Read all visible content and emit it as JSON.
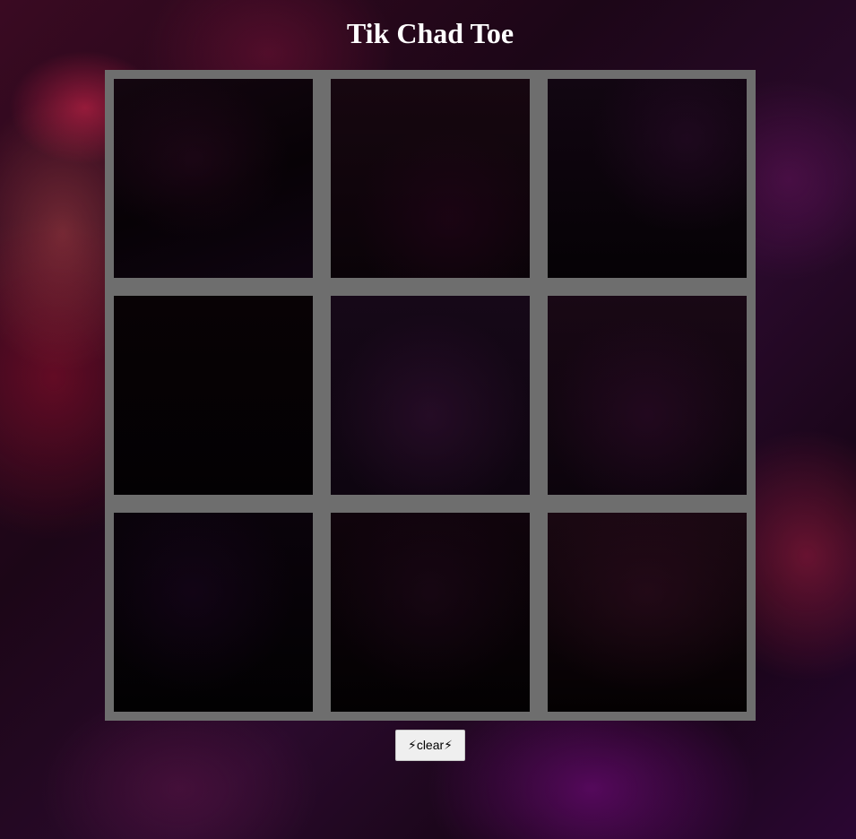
{
  "page": {
    "title": "Tik Chad Toe"
  },
  "board": {
    "cells": [
      "",
      "",
      "",
      "",
      "",
      "",
      "",
      "",
      ""
    ],
    "grid_color": "#6e6e6e"
  },
  "controls": {
    "clear_label": "⚡clear⚡"
  }
}
